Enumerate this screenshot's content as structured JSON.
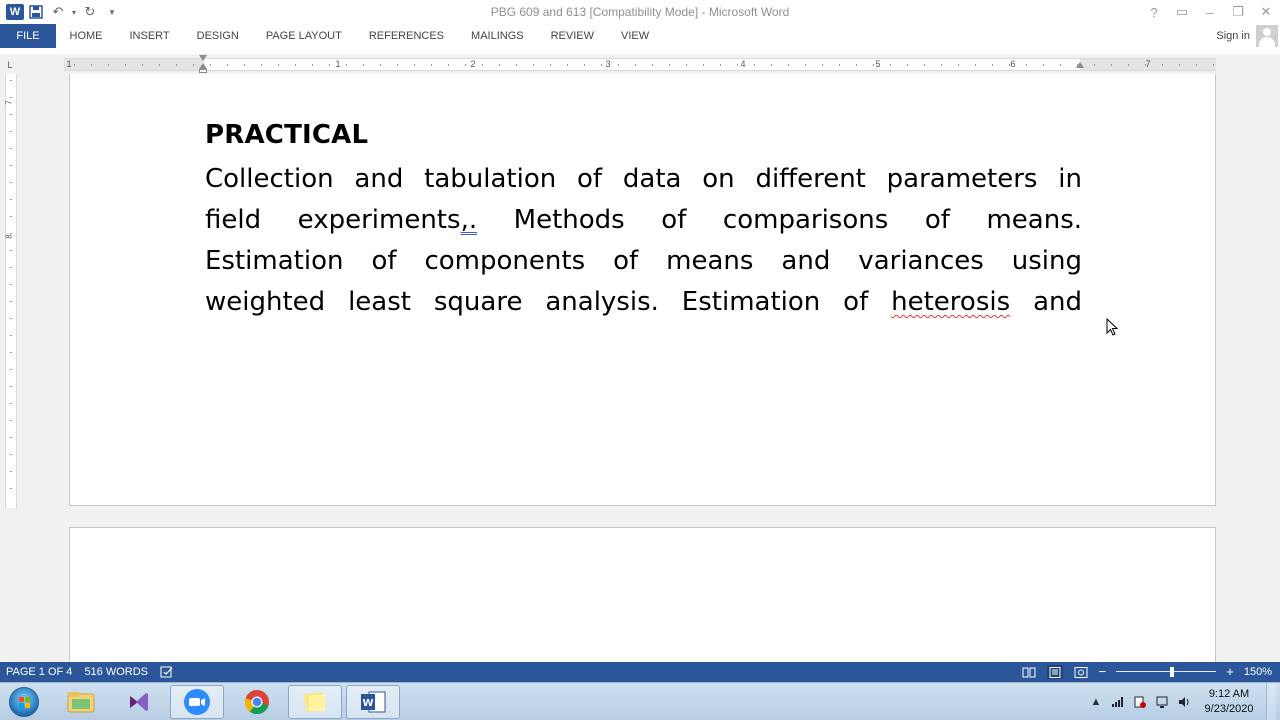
{
  "window": {
    "title": "PBG 609 and 613 [Compatibility Mode] - Microsoft Word",
    "app_logo": "W"
  },
  "ribbon": {
    "file_label": "FILE",
    "tabs": [
      "HOME",
      "INSERT",
      "DESIGN",
      "PAGE LAYOUT",
      "REFERENCES",
      "MAILINGS",
      "REVIEW",
      "VIEW"
    ],
    "signin_label": "Sign in"
  },
  "ruler": {
    "tab_selector": "L",
    "numbers": [
      "1",
      "1",
      "2",
      "3",
      "4",
      "5",
      "6",
      "7"
    ],
    "vertical_numbers": [
      "7",
      "8"
    ]
  },
  "document": {
    "heading": "PRACTICAL",
    "lines": [
      [
        "Collection and tabulation of data on different parameters in"
      ],
      [
        "field experiments",
        ",.",
        " Methods of comparisons of means."
      ],
      [
        "Estimation of components of means and variances using"
      ],
      [
        "weighted least square analysis. Estimation of ",
        "heterosis",
        " and"
      ]
    ]
  },
  "status": {
    "page": "PAGE 1 OF 4",
    "words": "516 WORDS",
    "zoom": "150%",
    "zoom_level_percent": 150
  },
  "taskbar": {
    "time": "9:12 AM",
    "date": "9/23/2020"
  },
  "colors": {
    "word_blue": "#2b579a",
    "canvas_gray": "#f1f1f1"
  }
}
